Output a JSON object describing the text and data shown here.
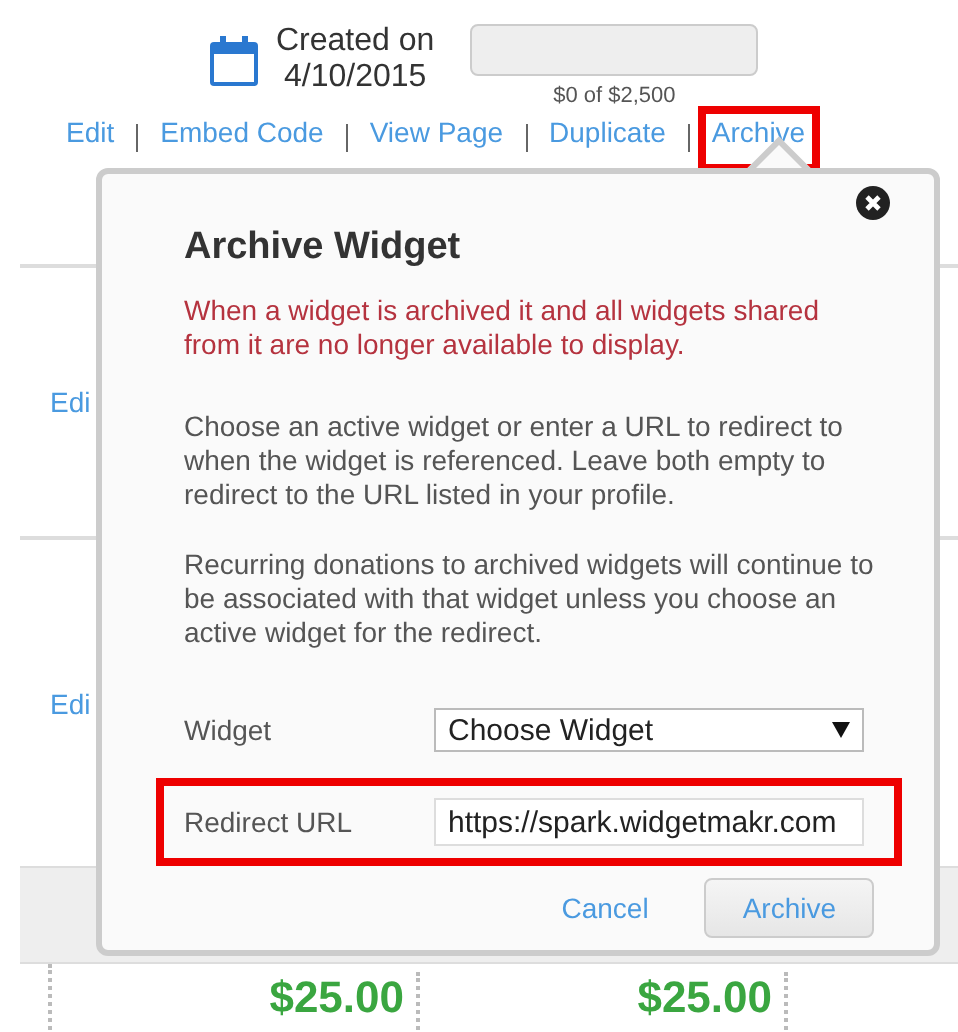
{
  "header": {
    "created_label": "Created on",
    "created_date": "4/10/2015",
    "progress": {
      "level": 0,
      "reading": "$0 of $2,500"
    }
  },
  "actions": [
    {
      "label": "Edit",
      "highlighted": false
    },
    {
      "label": "Embed Code",
      "highlighted": false
    },
    {
      "label": "View Page",
      "highlighted": false
    },
    {
      "label": "Duplicate",
      "highlighted": false
    },
    {
      "label": "Archive",
      "highlighted": true
    }
  ],
  "rows": [
    {
      "action": "Edi"
    },
    {
      "action": "Edi"
    }
  ],
  "amounts": [
    "$25.00",
    "$25.00"
  ],
  "dialog": {
    "title": "Archive Widget",
    "warning": "When a widget is archived it and all widgets shared from it are no longer available to display.",
    "paragraphs": [
      "Choose an active widget or enter a URL to redirect to when the widget is referenced. Leave both empty to redirect to the URL listed in your profile.",
      "Recurring donations to archived widgets will continue to be associated with that widget unless you choose an active widget for the redirect."
    ],
    "fields": [
      {
        "kind": "select",
        "label": "Widget",
        "value": "Choose Widget",
        "highlighted": false
      },
      {
        "kind": "text",
        "label": "Redirect URL",
        "value": "https://spark.widgetmakr.com",
        "highlighted": true
      }
    ],
    "cancel": "Cancel",
    "confirm": "Archive"
  }
}
